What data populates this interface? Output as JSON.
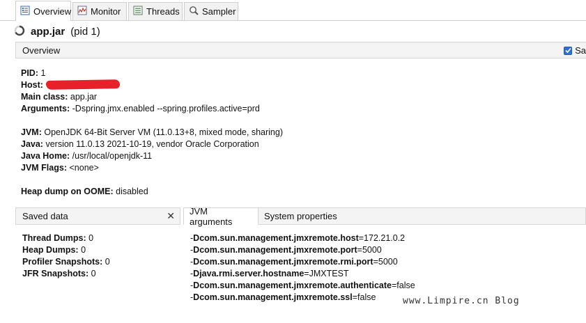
{
  "tabs": [
    {
      "label": "Overview",
      "icon": "overview-icon",
      "active": true
    },
    {
      "label": "Monitor",
      "icon": "monitor-icon",
      "active": false
    },
    {
      "label": "Threads",
      "icon": "threads-icon",
      "active": false
    },
    {
      "label": "Sampler",
      "icon": "sampler-icon",
      "active": false
    }
  ],
  "header": {
    "app_name": "app.jar",
    "pid_text": "(pid 1)",
    "icon": "spinner-icon"
  },
  "overview": {
    "section_label": "Overview",
    "checkbox_label": "Sa",
    "checkbox_checked": true,
    "pid": {
      "label": "PID:",
      "value": "1"
    },
    "host": {
      "label": "Host:",
      "redacted": true
    },
    "main_class": {
      "label": "Main class:",
      "value": "app.jar"
    },
    "arguments": {
      "label": "Arguments:",
      "value": "-Dspring.jmx.enabled --spring.profiles.active=prd"
    },
    "jvm": {
      "label": "JVM:",
      "value": "OpenJDK 64-Bit Server VM (11.0.13+8, mixed mode, sharing)"
    },
    "java": {
      "label": "Java:",
      "value": "version 11.0.13 2021-10-19, vendor Oracle Corporation"
    },
    "java_home": {
      "label": "Java Home:",
      "value": "/usr/local/openjdk-11"
    },
    "jvm_flags": {
      "label": "JVM Flags:",
      "value": "<none>"
    },
    "heap_dump": {
      "label": "Heap dump on OOME:",
      "value": "disabled"
    }
  },
  "saved_data": {
    "title": "Saved data",
    "close": "✕",
    "items": [
      {
        "label": "Thread Dumps:",
        "value": "0"
      },
      {
        "label": "Heap Dumps:",
        "value": "0"
      },
      {
        "label": "Profiler Snapshots:",
        "value": "0"
      },
      {
        "label": "JFR Snapshots:",
        "value": "0"
      }
    ]
  },
  "right_tabs": [
    {
      "label": "JVM arguments",
      "active": true
    },
    {
      "label": "System properties",
      "active": false
    }
  ],
  "jvm_arguments": [
    {
      "prefix": "-",
      "key": "Dcom.sun.management.jmxremote.host",
      "suffix": "=172.21.0.2"
    },
    {
      "prefix": "-",
      "key": "Dcom.sun.management.jmxremote.port",
      "suffix": "=5000"
    },
    {
      "prefix": "-",
      "key": "Dcom.sun.management.jmxremote.rmi.port",
      "suffix": "=5000"
    },
    {
      "prefix": "-",
      "key": "Djava.rmi.server.hostname",
      "suffix": "=JMXTEST"
    },
    {
      "prefix": "-",
      "key": "Dcom.sun.management.jmxremote.authenticate",
      "suffix": "=false"
    },
    {
      "prefix": "-",
      "key": "Dcom.sun.management.jmxremote.ssl",
      "suffix": "=false"
    }
  ],
  "watermark": "www.Limpire.cn Blog",
  "colors": {
    "accent": "#2f6fd6",
    "redaction": "#e8202a"
  }
}
